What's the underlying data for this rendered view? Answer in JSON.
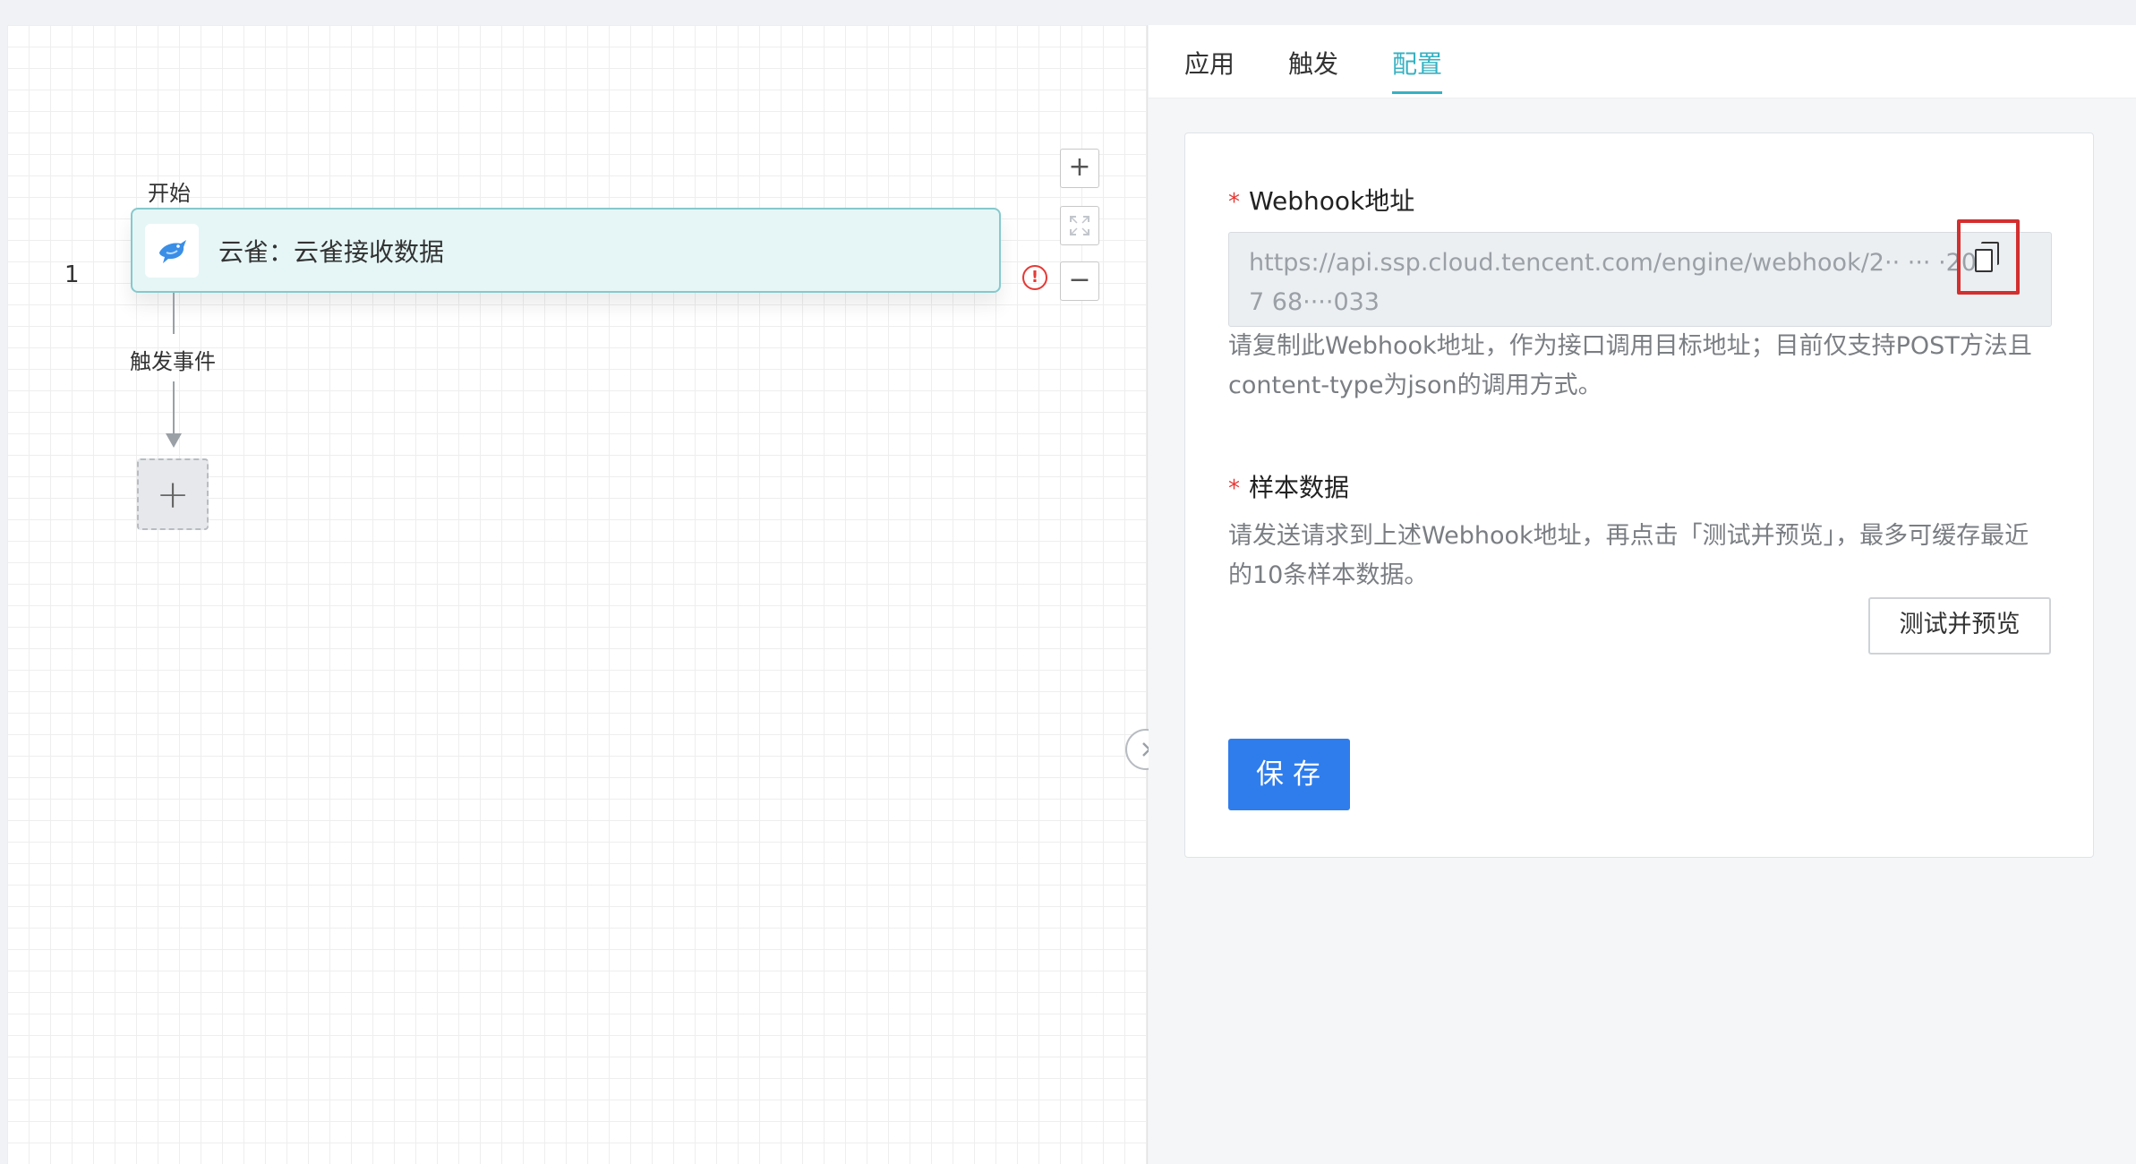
{
  "canvas": {
    "start_label": "开始",
    "step_index": "1",
    "node_title": "云雀：云雀接收数据",
    "trigger_label": "触发事件",
    "add_symbol": "+",
    "zoom_in_symbol": "+",
    "zoom_out_symbol": "−",
    "error_symbol": "!"
  },
  "tabs": {
    "apply": "应用",
    "trigger": "触发",
    "config": "配置",
    "active": "config"
  },
  "config": {
    "webhook_label": "Webhook地址",
    "webhook_url": "https://api.ssp.cloud.tencent.com/engine/webhook/2·· ··· ·207 68····033",
    "webhook_hint": "请复制此Webhook地址，作为接口调用目标地址；目前仅支持POST方法且content-type为json的调用方式。",
    "sample_label": "样本数据",
    "sample_hint": "请发送请求到上述Webhook地址，再点击「测试并预览」，最多可缓存最近的10条样本数据。",
    "preview_button": "测试并预览",
    "save_button": "保存",
    "required_mark": "*"
  },
  "colors": {
    "accent": "#36b1c2",
    "primary": "#2f7dec",
    "node_bg": "#e6f6f6",
    "node_border": "#86c9cd",
    "error": "#e53935",
    "highlight_box": "#d32f2f"
  },
  "icons": {
    "node_icon": "bird-icon",
    "copy_icon": "copy-icon",
    "error_icon": "error-circle-icon",
    "collapse_icon": "chevron-right-icon"
  }
}
